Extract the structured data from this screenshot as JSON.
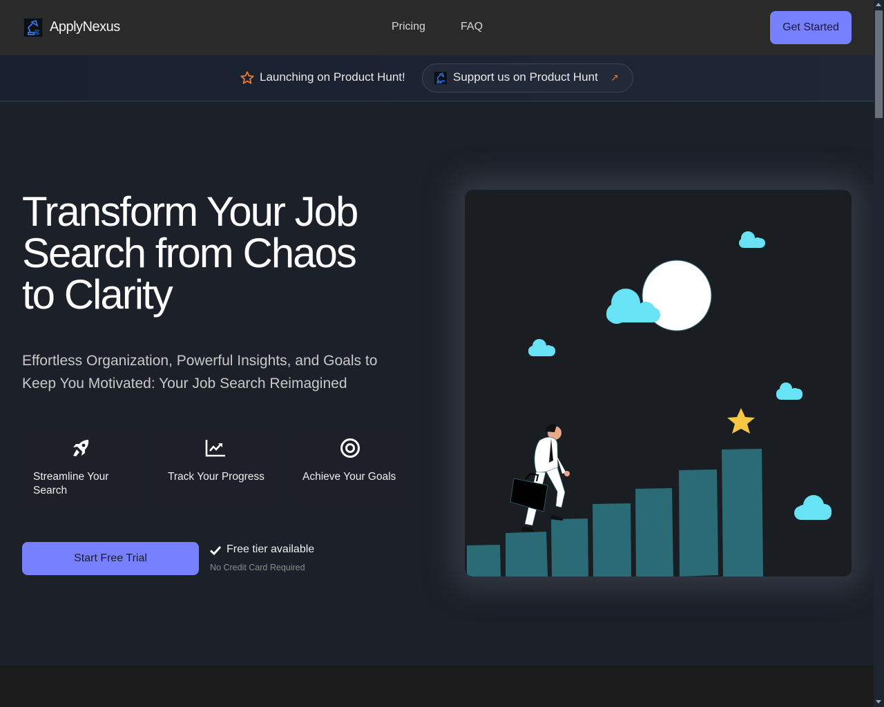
{
  "header": {
    "brand": "ApplyNexus",
    "logo_icon": "desk-lamp-icon",
    "nav": [
      {
        "label": "Pricing"
      },
      {
        "label": "FAQ"
      }
    ],
    "cta_label": "Get Started"
  },
  "banner": {
    "star_icon": "star-outline-icon",
    "text": "Launching on Product Hunt!",
    "pill_label": "Support us on Product Hunt",
    "pill_arrow": "↗"
  },
  "hero": {
    "headline_lines": [
      "Transform Your Job",
      "Search from Chaos",
      "to Clarity"
    ],
    "subheadline": "Effortless Organization, Powerful Insights, and Goals to Keep You Motivated: Your Job Search Reimagined",
    "features": [
      {
        "icon": "rocket-icon",
        "label": "Streamline Your Search"
      },
      {
        "icon": "trending-chart-icon",
        "label": "Track Your Progress"
      },
      {
        "icon": "target-icon",
        "label": "Achieve Your Goals"
      }
    ],
    "cta_label": "Start Free Trial",
    "free_tier_label": "Free tier available",
    "no_cc_label": "No Credit Card Required"
  },
  "illustration": {
    "description": "Businessman with briefcase climbing bar-chart steps toward a star under the moon and clouds"
  },
  "colors": {
    "accent": "#7781ff",
    "header_bg": "#2a2a2a",
    "hero_bg": "#1c2029",
    "bar_teal": "#2b6b76",
    "cloud_cyan": "#67e3f5",
    "star_gold": "#f7c744",
    "ph_orange": "#f07b2a"
  }
}
